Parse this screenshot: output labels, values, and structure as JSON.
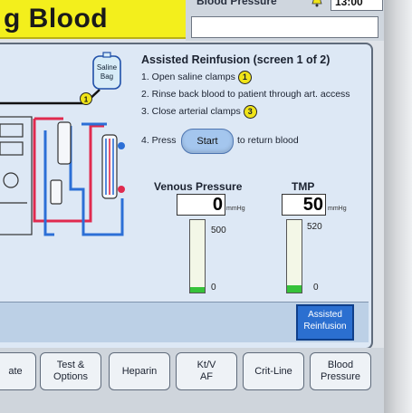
{
  "header": {
    "title": "g  Blood",
    "bp_label": "Blood  Pressure",
    "clock": "13:00"
  },
  "instructions": {
    "title": "Assisted  Reinfusion  (screen  1  of  2)",
    "steps": [
      {
        "text": "1. Open saline clamps",
        "clamp": "1"
      },
      {
        "text": "2. Rinse back blood to patient through art. access"
      },
      {
        "text": "3. Close arterial clamps",
        "clamp": "3"
      }
    ],
    "press_label": "4. Press",
    "start_label": "Start",
    "press_after": "to return blood"
  },
  "diagram": {
    "saline_bag_label_1": "Saline",
    "saline_bag_label_2": "Bag",
    "clamp_label": "1"
  },
  "venous": {
    "label": "Venous  Pressure",
    "value": "0",
    "unit": "mmHg",
    "scale_max": "500",
    "scale_min": "0",
    "level_fraction": 0.0
  },
  "tmp": {
    "label": "TMP",
    "value": "50",
    "unit": "mmHg",
    "scale_max": "520",
    "scale_min": "0",
    "level_fraction": 0.1
  },
  "assist_button": {
    "line1": "Assisted",
    "line2": "Reinfusion"
  },
  "tabs": [
    {
      "line1": "ate",
      "line2": ""
    },
    {
      "line1": "Test &",
      "line2": "Options"
    },
    {
      "line1": "Heparin",
      "line2": ""
    },
    {
      "line1": "Kt/V",
      "line2": "AF"
    },
    {
      "line1": "Crit-Line",
      "line2": ""
    },
    {
      "line1": "Blood",
      "line2": "Pressure"
    }
  ],
  "colors": {
    "title_bg": "#f3ef1c",
    "panel_bg": "#dde8f5",
    "accent_blue": "#2b6fd0",
    "gauge_green": "#36c23a",
    "arterial_red": "#e02a4e",
    "venous_blue": "#2c6fd6"
  }
}
